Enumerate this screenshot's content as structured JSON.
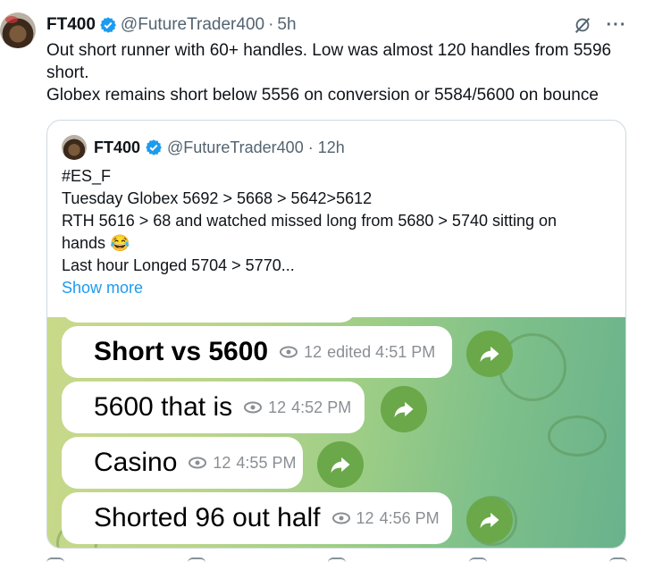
{
  "post": {
    "name": "FT400",
    "handle": "@FutureTrader400",
    "separator": "·",
    "time": "5h",
    "more_label": "···",
    "lines": [
      "Out short runner with 60+ handles. Low was almost 120 handles from 5596",
      "short.",
      "Globex remains short below 5556 on conversion or 5584/5600 on bounce"
    ]
  },
  "quote": {
    "name": "FT400",
    "handle": "@FutureTrader400",
    "separator": "·",
    "time": "12h",
    "lines": [
      "#ES_F",
      "Tuesday Globex 5692 > 5668 > 5642>5612",
      "RTH 5616 > 68 and watched missed long from 5680 > 5740 sitting on",
      "hands 😂",
      "Last hour Longed 5704  > 5770..."
    ],
    "show_more": "Show more"
  },
  "media": {
    "messages": [
      {
        "text": "Short vs 5600",
        "views": "12",
        "meta": "edited 4:51 PM"
      },
      {
        "text": "5600 that is",
        "views": "12",
        "meta": "4:52 PM"
      },
      {
        "text": "Casino",
        "views": "12",
        "meta": "4:55 PM"
      },
      {
        "text": "Shorted 96 out half",
        "views": "12",
        "meta": "4:56 PM"
      }
    ]
  },
  "colors": {
    "verified": "#1d9bf0",
    "link": "#1d9bf0",
    "forward_button": "#6aa84a"
  }
}
